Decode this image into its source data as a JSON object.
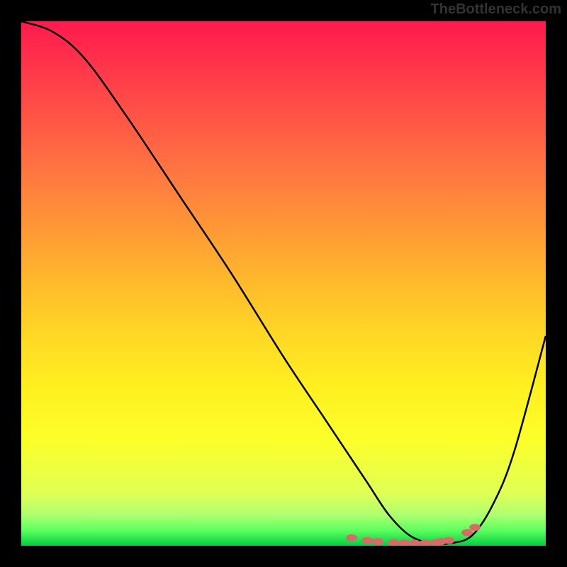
{
  "watermark": "TheBottleneck.com",
  "chart_data": {
    "type": "line",
    "title": "",
    "xlabel": "",
    "ylabel": "",
    "xlim": [
      0,
      100
    ],
    "ylim": [
      0,
      100
    ],
    "series": [
      {
        "name": "curve",
        "x": [
          0,
          6,
          12,
          20,
          30,
          40,
          50,
          58,
          62,
          66,
          70,
          74,
          78,
          82,
          86,
          90,
          94,
          100
        ],
        "y": [
          100,
          98,
          93,
          82,
          67,
          52,
          36,
          24,
          18,
          12,
          6,
          2,
          0.5,
          0.5,
          2,
          8,
          18,
          40
        ]
      }
    ],
    "markers": {
      "name": "bottleneck-points",
      "color": "#d86a6a",
      "points": [
        {
          "x": 63,
          "y": 1.5
        },
        {
          "x": 66,
          "y": 1.0
        },
        {
          "x": 68,
          "y": 0.8
        },
        {
          "x": 71,
          "y": 0.6
        },
        {
          "x": 73,
          "y": 0.5
        },
        {
          "x": 75,
          "y": 0.5
        },
        {
          "x": 77,
          "y": 0.5
        },
        {
          "x": 79,
          "y": 0.6
        },
        {
          "x": 80,
          "y": 0.8
        },
        {
          "x": 81.5,
          "y": 1.0
        },
        {
          "x": 85,
          "y": 2.5
        },
        {
          "x": 86.5,
          "y": 3.5
        }
      ]
    },
    "gradient_colors": {
      "top": "#ff1a4e",
      "mid_upper": "#ff7a40",
      "mid": "#ffd825",
      "mid_lower": "#fcff2a",
      "bottom": "#00d040"
    }
  }
}
